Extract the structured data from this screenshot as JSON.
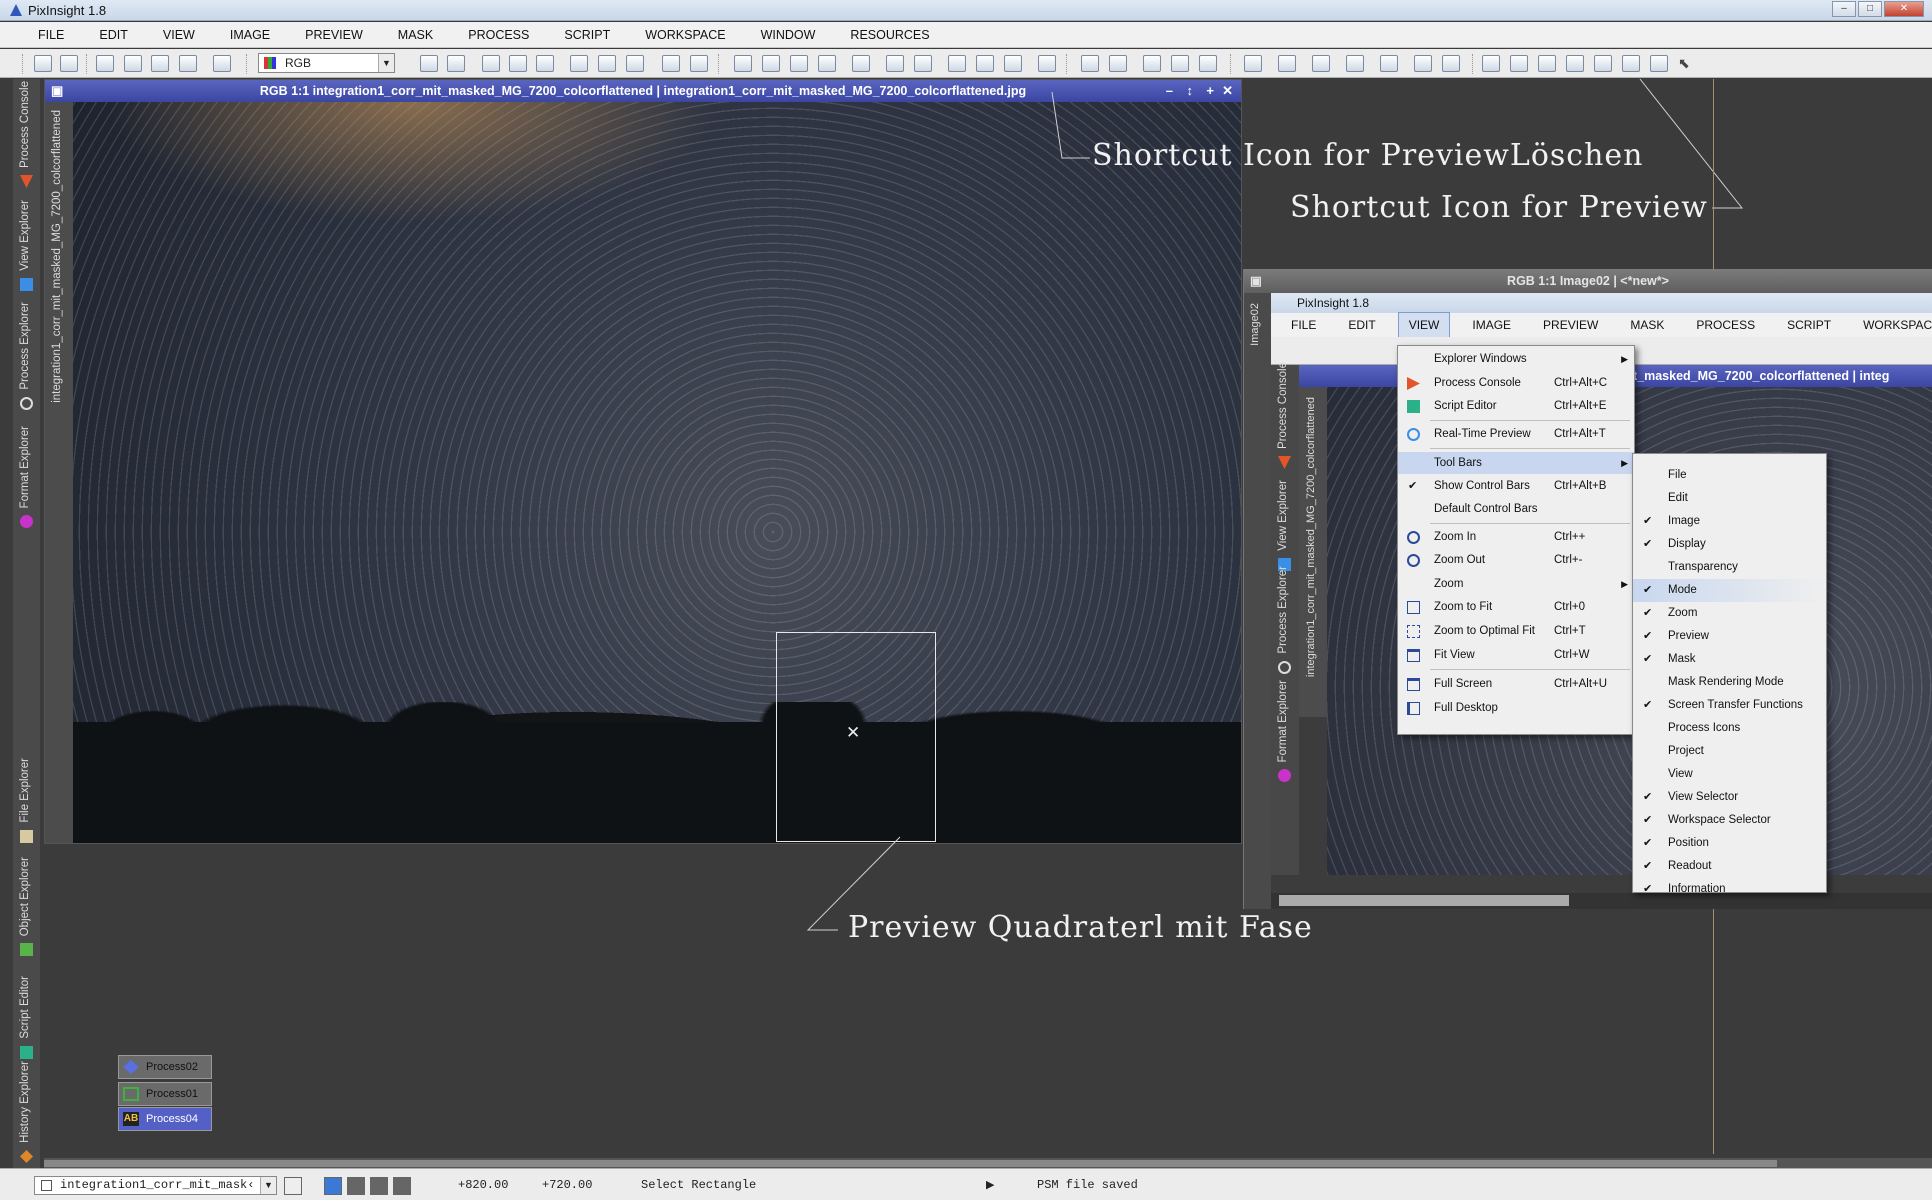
{
  "app": {
    "title": "PixInsight 1.8"
  },
  "menu": [
    "FILE",
    "EDIT",
    "VIEW",
    "IMAGE",
    "PREVIEW",
    "MASK",
    "PROCESS",
    "SCRIPT",
    "WORKSPACE",
    "WINDOW",
    "RESOURCES"
  ],
  "toolbar": {
    "color_mode": "RGB"
  },
  "left_tabs": [
    "Process Console",
    "View Explorer",
    "Process Explorer",
    "Format Explorer",
    "File Explorer",
    "Object Explorer",
    "Script Editor",
    "History Explorer"
  ],
  "main_window": {
    "title": "RGB 1:1 integration1_corr_mit_masked_MG_7200_colcorflattened | integration1_corr_mit_masked_MG_7200_colcorflattened.jpg",
    "side_label": "integration1_corr_mit_masked_MG_7200_colcorflattened"
  },
  "annotations": {
    "a1": "Shortcut Icon for PreviewLöschen",
    "a2": "Shortcut Icon for Preview",
    "a3": "Preview Quadraterl mit Fase"
  },
  "inset": {
    "window_title": "RGB 1:1 Image02 | <*new*>",
    "side_label": "Image02",
    "app_title": "PixInsight 1.8",
    "menu": [
      "FILE",
      "EDIT",
      "VIEW",
      "IMAGE",
      "PREVIEW",
      "MASK",
      "PROCESS",
      "SCRIPT",
      "WORKSPACE"
    ],
    "image_bar": "t_masked_MG_7200_colcorflattened | integ",
    "image_side_label": "integration1_corr_mit_masked_MG_7200_colcorflattened",
    "side_tabs": [
      "Process Console",
      "View Explorer",
      "Process Explorer",
      "Format Explorer"
    ]
  },
  "view_menu": [
    {
      "label": "Explorer Windows",
      "shortcut": "",
      "arrow": true
    },
    {
      "label": "Process Console",
      "shortcut": "Ctrl+Alt+C",
      "icon": "process-console-icon"
    },
    {
      "label": "Script Editor",
      "shortcut": "Ctrl+Alt+E",
      "icon": "script-editor-icon"
    },
    {
      "label": "Real-Time Preview",
      "shortcut": "Ctrl+Alt+T",
      "icon": "realtime-preview-icon"
    },
    {
      "label": "Tool Bars",
      "shortcut": "",
      "arrow": true,
      "highlight": true
    },
    {
      "label": "Show Control Bars",
      "shortcut": "Ctrl+Alt+B",
      "check": true
    },
    {
      "label": "Default Control Bars",
      "shortcut": ""
    },
    {
      "label": "Zoom In",
      "shortcut": "Ctrl++",
      "icon": "zoom-in-icon"
    },
    {
      "label": "Zoom Out",
      "shortcut": "Ctrl+-",
      "icon": "zoom-out-icon"
    },
    {
      "label": "Zoom",
      "shortcut": "",
      "arrow": true
    },
    {
      "label": "Zoom to Fit",
      "shortcut": "Ctrl+0",
      "icon": "zoom-fit-icon"
    },
    {
      "label": "Zoom to Optimal Fit",
      "shortcut": "Ctrl+T",
      "icon": "zoom-optimal-icon"
    },
    {
      "label": "Fit View",
      "shortcut": "Ctrl+W",
      "icon": "fit-view-icon"
    },
    {
      "label": "Full Screen",
      "shortcut": "Ctrl+Alt+U",
      "icon": "full-screen-icon"
    },
    {
      "label": "Full Desktop",
      "shortcut": "",
      "icon": "full-desktop-icon"
    }
  ],
  "toolbars_submenu": [
    {
      "label": "File",
      "checked": false
    },
    {
      "label": "Edit",
      "checked": false
    },
    {
      "label": "Image",
      "checked": true
    },
    {
      "label": "Display",
      "checked": true
    },
    {
      "label": "Transparency",
      "checked": false
    },
    {
      "label": "Mode",
      "checked": true,
      "highlight": true
    },
    {
      "label": "Zoom",
      "checked": true
    },
    {
      "label": "Preview",
      "checked": true
    },
    {
      "label": "Mask",
      "checked": true
    },
    {
      "label": "Mask Rendering Mode",
      "checked": false
    },
    {
      "label": "Screen Transfer Functions",
      "checked": true
    },
    {
      "label": "Process Icons",
      "checked": false
    },
    {
      "label": "Project",
      "checked": false
    },
    {
      "label": "View",
      "checked": false
    },
    {
      "label": "View Selector",
      "checked": true
    },
    {
      "label": "Workspace Selector",
      "checked": true
    },
    {
      "label": "Position",
      "checked": true
    },
    {
      "label": "Readout",
      "checked": true
    },
    {
      "label": "Information",
      "checked": true
    }
  ],
  "process_icons": [
    {
      "label": "Process02",
      "selected": false,
      "icon": "process02-icon"
    },
    {
      "label": "Process01",
      "selected": false,
      "icon": "process01-icon"
    },
    {
      "label": "Process04",
      "selected": true,
      "icon": "process04-icon",
      "badge": "AB"
    }
  ],
  "status": {
    "view": "integration1_corr_mit_mask‹",
    "x": "+820.00",
    "y": "+720.00",
    "mode": "Select Rectangle",
    "message": "PSM file saved"
  }
}
